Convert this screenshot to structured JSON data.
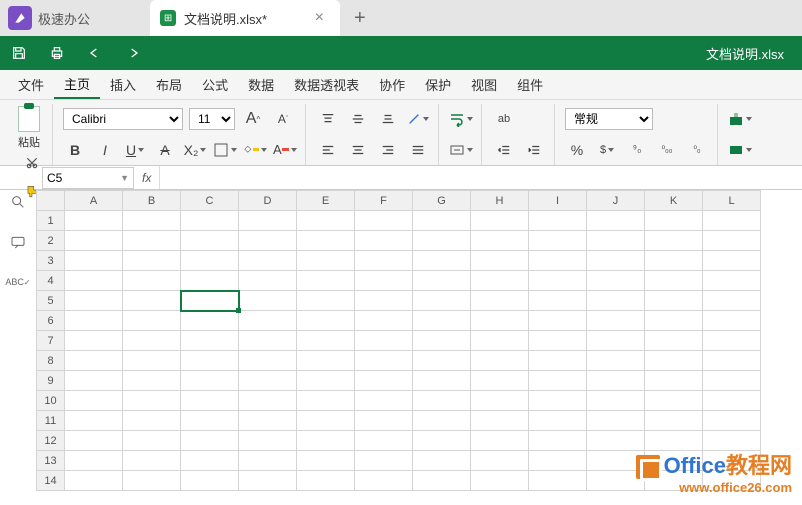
{
  "app": {
    "name": "极速办公"
  },
  "tab": {
    "title": "文档说明.xlsx*"
  },
  "doc_title": "文档说明.xlsx",
  "menu": {
    "items": [
      "文件",
      "主页",
      "插入",
      "布局",
      "公式",
      "数据",
      "数据透视表",
      "协作",
      "保护",
      "视图",
      "组件"
    ],
    "active": 1
  },
  "ribbon": {
    "paste_label": "粘贴",
    "font_name": "Calibri",
    "font_size": "11",
    "bold": "B",
    "italic": "I",
    "underline": "U",
    "strike": "A",
    "sub": "X₂",
    "bigA": "A",
    "smallA": "A",
    "format_label": "常规",
    "percent": "%",
    "comma": "⁹₀",
    "dec_inc": "⁰₀₀",
    "dec_dec": "⁰₀"
  },
  "formula_bar": {
    "cell_ref": "C5",
    "fx": "fx"
  },
  "side": {
    "abc": "ABC"
  },
  "grid": {
    "cols": [
      "A",
      "B",
      "C",
      "D",
      "E",
      "F",
      "G",
      "H",
      "I",
      "J",
      "K",
      "L"
    ],
    "rows": [
      "1",
      "2",
      "3",
      "4",
      "5",
      "6",
      "7",
      "8",
      "9",
      "10",
      "11",
      "12",
      "13",
      "14"
    ],
    "selected": {
      "row": 5,
      "col": "C"
    }
  },
  "watermark": {
    "brand1": "Office",
    "brand2": "教程网",
    "url": "www.office26.com"
  }
}
